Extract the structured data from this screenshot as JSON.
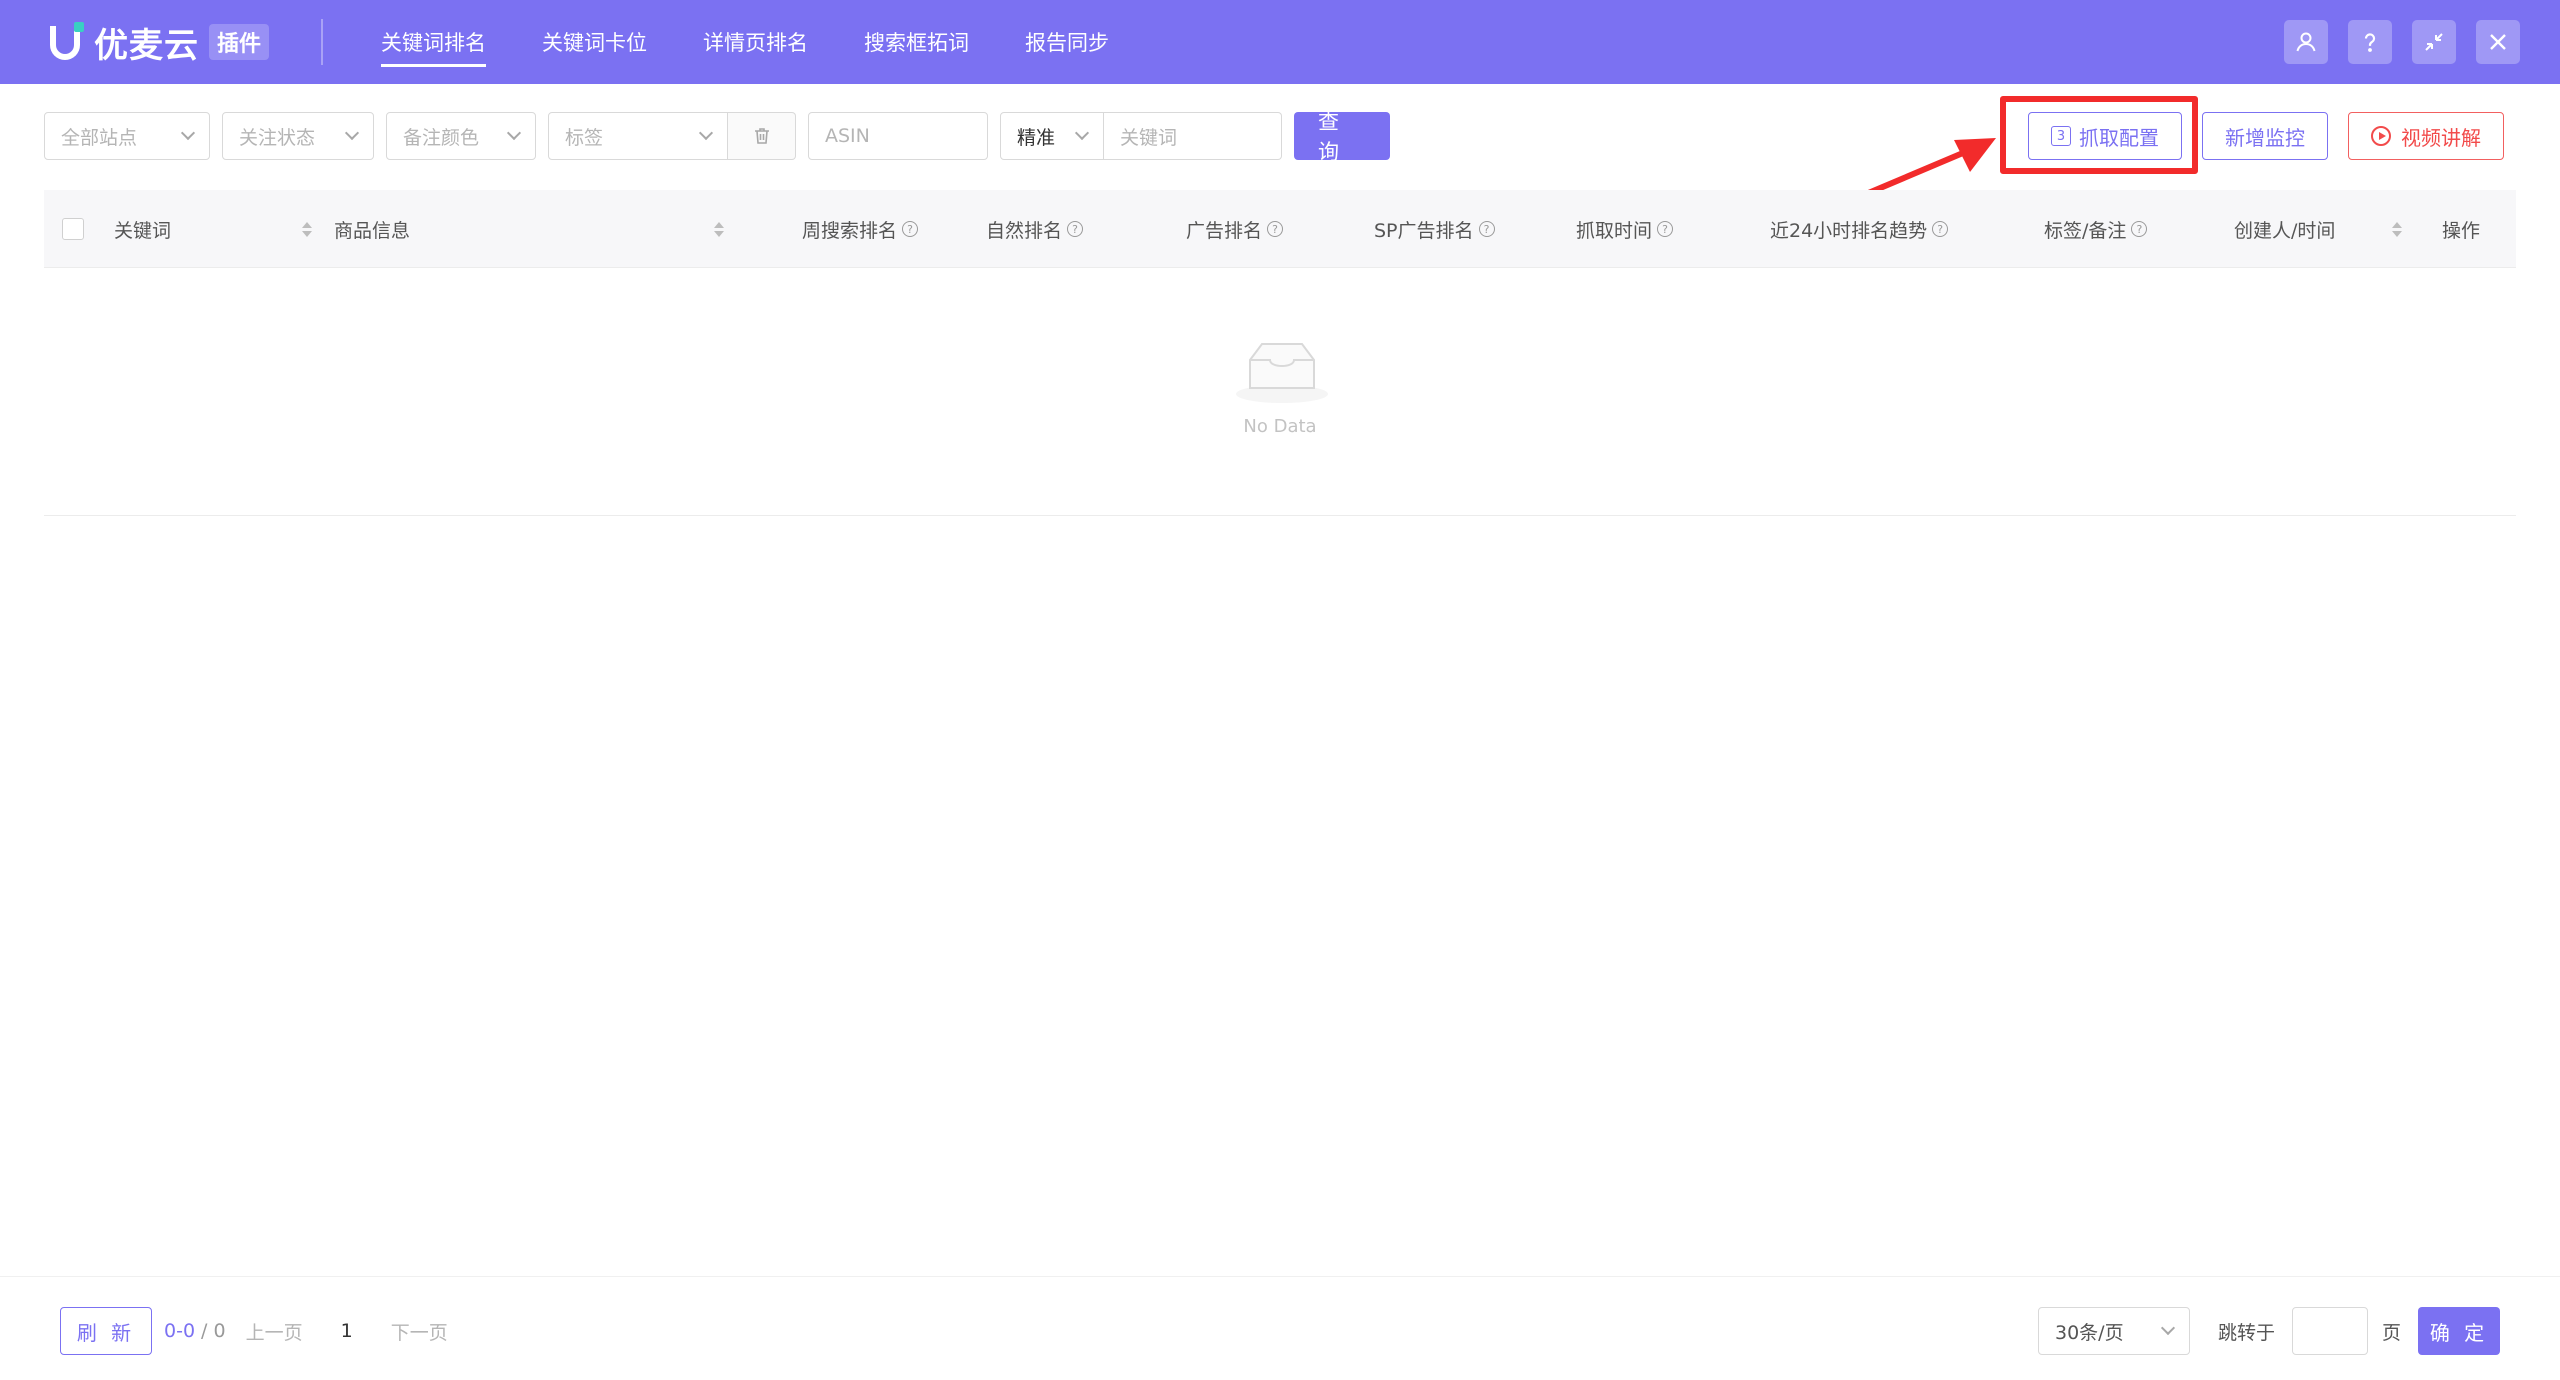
{
  "header": {
    "logo_text": "优麦云",
    "logo_badge": "插件",
    "nav": [
      {
        "label": "关键词排名",
        "active": true
      },
      {
        "label": "关键词卡位"
      },
      {
        "label": "详情页排名"
      },
      {
        "label": "搜索框拓词"
      },
      {
        "label": "报告同步"
      }
    ],
    "icons": [
      "user-icon",
      "help-icon",
      "minimize-icon",
      "close-icon"
    ]
  },
  "filters": {
    "site": "全部站点",
    "follow_status": "关注状态",
    "note_color": "备注颜色",
    "tag": "标签",
    "asin_placeholder": "ASIN",
    "match_mode": "精准",
    "keyword_placeholder": "关键词",
    "query_button": "查 询"
  },
  "actions": {
    "crawl_config_num": "3",
    "crawl_config": "抓取配置",
    "add_monitor": "新增监控",
    "video_guide": "视频讲解"
  },
  "table": {
    "columns": {
      "keyword": "关键词",
      "product": "商品信息",
      "weekly_rank": "周搜索排名",
      "natural_rank": "自然排名",
      "ad_rank": "广告排名",
      "sp_ad_rank": "SP广告排名",
      "crawl_time": "抓取时间",
      "trend_24h": "近24小时排名趋势",
      "tags_notes": "标签/备注",
      "creator_time": "创建人/时间",
      "ops": "操作"
    },
    "empty_text": "No Data"
  },
  "footer": {
    "refresh": "刷 新",
    "range": "0-0",
    "total": "/ 0",
    "prev": "上一页",
    "page": "1",
    "next": "下一页",
    "page_size": "30条/页",
    "jump_label": "跳转于",
    "jump_unit": "页",
    "confirm": "确 定"
  },
  "colors": {
    "primary": "#7B71F2",
    "danger": "#F24B4B",
    "annotation": "#F22B2B"
  }
}
